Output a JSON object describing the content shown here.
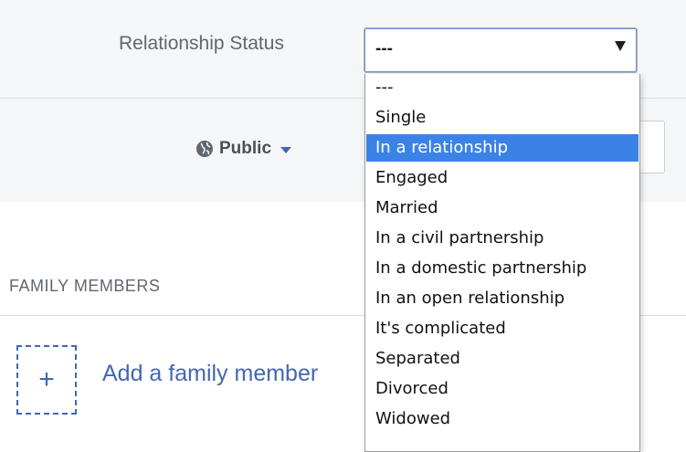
{
  "relationship": {
    "label": "Relationship Status",
    "select_value": "---",
    "options": [
      "---",
      "Single",
      "In a relationship",
      "Engaged",
      "Married",
      "In a civil partnership",
      "In a domestic partnership",
      "In an open relationship",
      "It's complicated",
      "Separated",
      "Divorced",
      "Widowed"
    ],
    "highlighted_option": "In a relationship"
  },
  "privacy": {
    "label": "Public",
    "icon": "globe-icon"
  },
  "family": {
    "section_title": "FAMILY MEMBERS",
    "add_label": "Add a family member",
    "add_icon": "+"
  },
  "colors": {
    "link": "#4267b2",
    "highlight": "#3b82e6"
  }
}
